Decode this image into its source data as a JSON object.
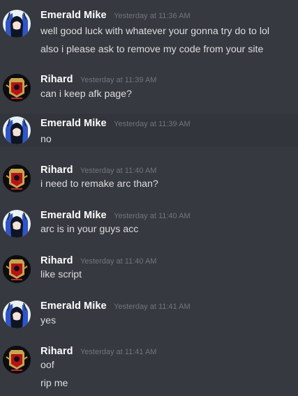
{
  "messages": [
    {
      "username": "Emerald Mike",
      "timestamp": "Yesterday at 11:36 AM",
      "avatar": "emerald-mike-avatar",
      "lines": [
        "well good luck with whatever your gonna try do to lol",
        "also i please ask to remove my code from your site"
      ]
    },
    {
      "username": "Rihard",
      "timestamp": "Yesterday at 11:39 AM",
      "avatar": "rihard-avatar",
      "lines": [
        "can i keep afk page?"
      ]
    },
    {
      "username": "Emerald Mike",
      "timestamp": "Yesterday at 11:39 AM",
      "avatar": "emerald-mike-avatar",
      "lines": [
        "no"
      ]
    },
    {
      "username": "Rihard",
      "timestamp": "Yesterday at 11:40 AM",
      "avatar": "rihard-avatar",
      "lines": [
        "i need to remake arc than?"
      ]
    },
    {
      "username": "Emerald Mike",
      "timestamp": "Yesterday at 11:40 AM",
      "avatar": "emerald-mike-avatar",
      "lines": [
        "arc is in your guys acc"
      ]
    },
    {
      "username": "Rihard",
      "timestamp": "Yesterday at 11:40 AM",
      "avatar": "rihard-avatar",
      "lines": [
        "like script"
      ]
    },
    {
      "username": "Emerald Mike",
      "timestamp": "Yesterday at 11:41 AM",
      "avatar": "emerald-mike-avatar",
      "lines": [
        "yes"
      ]
    },
    {
      "username": "Rihard",
      "timestamp": "Yesterday at 11:41 AM",
      "avatar": "rihard-avatar",
      "lines": [
        "oof",
        "rip me"
      ]
    }
  ],
  "colors": {
    "background": "#36393f",
    "hover_background": "#32353b",
    "username": "#ffffff",
    "timestamp": "#72767d",
    "message_text": "#dcddde"
  }
}
